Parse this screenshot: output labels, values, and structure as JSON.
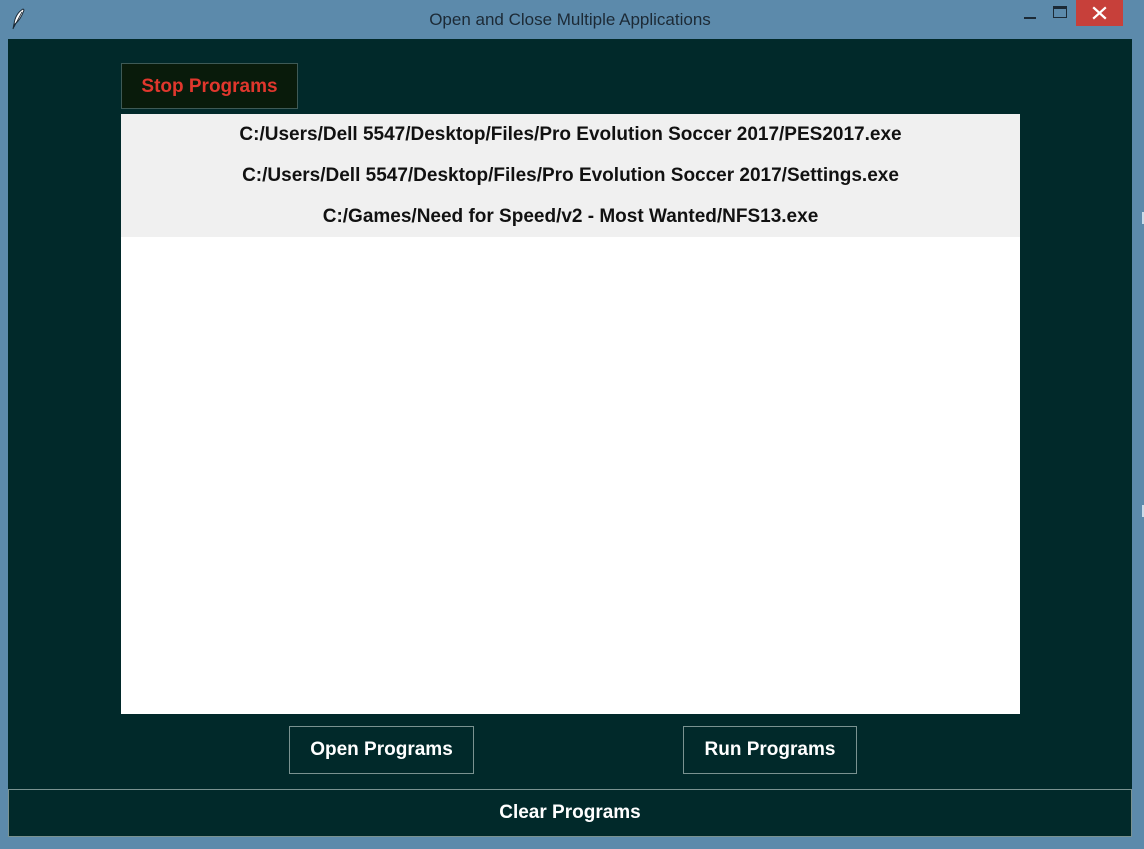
{
  "window": {
    "title": "Open and Close Multiple Applications",
    "app_icon": "feather-icon",
    "controls": {
      "minimize_icon": "minimize-icon",
      "maximize_icon": "maximize-icon",
      "close_icon": "close-icon"
    },
    "colors": {
      "frame": "#5c8aab",
      "client_background": "#01292a",
      "close_button": "#c7403a"
    }
  },
  "toolbar": {
    "stop_label": "Stop Programs",
    "stop_color": "#e0372d"
  },
  "program_list": {
    "items": [
      "C:/Users/Dell 5547/Desktop/Files/Pro Evolution Soccer 2017/PES2017.exe",
      "C:/Users/Dell 5547/Desktop/Files/Pro Evolution Soccer 2017/Settings.exe",
      "C:/Games/Need for Speed/v2 - Most Wanted/NFS13.exe"
    ]
  },
  "actions": {
    "open_label": "Open Programs",
    "run_label": "Run Programs",
    "clear_label": "Clear Programs"
  }
}
